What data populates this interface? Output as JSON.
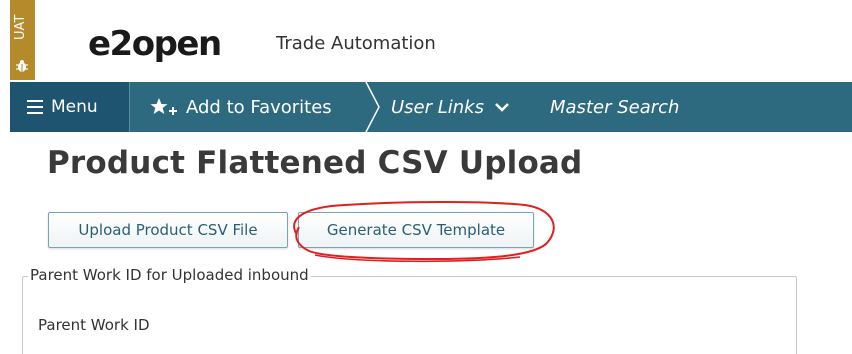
{
  "env_badge": {
    "label": "UAT"
  },
  "header": {
    "logo": "e2open",
    "app_name": "Trade Automation"
  },
  "nav": {
    "menu_label": "Menu",
    "favorites_label": "Add to Favorites",
    "user_links_label": "User Links",
    "master_search_label": "Master Search"
  },
  "page": {
    "title": "Product Flattened CSV Upload",
    "upload_button": "Upload Product CSV File",
    "generate_button": "Generate CSV Template",
    "fieldset_legend": "Parent Work ID for Uploaded inbound",
    "field_label": "Parent Work ID"
  },
  "colors": {
    "nav_bg": "#2d6a80",
    "menu_bg": "#1f5470",
    "env_badge": "#b48a2b",
    "annotation": "#e02020"
  }
}
